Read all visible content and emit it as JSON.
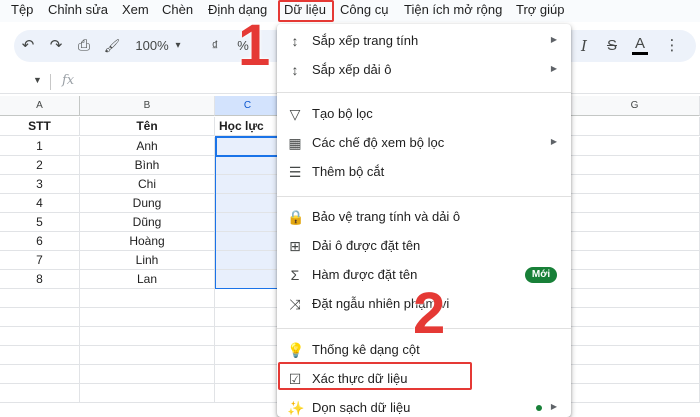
{
  "menubar": {
    "items": [
      {
        "label": "Tệp"
      },
      {
        "label": "Chỉnh sửa"
      },
      {
        "label": "Xem"
      },
      {
        "label": "Chèn"
      },
      {
        "label": "Định dạng"
      },
      {
        "label": "Dữ liệu"
      },
      {
        "label": "Công cụ"
      },
      {
        "label": "Tiện ích mở rộng"
      },
      {
        "label": "Trợ giúp"
      }
    ]
  },
  "toolbar": {
    "undo_icon": "↶",
    "redo_icon": "↷",
    "print_icon": "⎙",
    "paint_format_icon": "🖌",
    "zoom": "100%",
    "zoom_arrow": "▾",
    "currency": "₫",
    "percent": "%",
    "italic": "I",
    "strike": "S",
    "text_color": "A",
    "more": "⋮"
  },
  "formula_bar": {
    "fx": "fx",
    "dropdown": "▼"
  },
  "columns": [
    "A",
    "B",
    "C",
    "G"
  ],
  "table": {
    "headers": [
      "STT",
      "Tên",
      "Học lực"
    ],
    "rows": [
      [
        "1",
        "Anh"
      ],
      [
        "2",
        "Bình"
      ],
      [
        "3",
        "Chi"
      ],
      [
        "4",
        "Dung"
      ],
      [
        "5",
        "Dũng"
      ],
      [
        "6",
        "Hoàng"
      ],
      [
        "7",
        "Linh"
      ],
      [
        "8",
        "Lan"
      ]
    ]
  },
  "data_menu": {
    "items": [
      {
        "label": "Sắp xếp trang tính",
        "icon": "sort-icon"
      },
      {
        "label": "Sắp xếp dải ô",
        "icon": "sort-icon"
      },
      {
        "label": "Tạo bộ lọc",
        "icon": "filter-icon"
      },
      {
        "label": "Các chế độ xem bộ lọc",
        "icon": "filter-views-icon"
      },
      {
        "label": "Thêm bộ cắt",
        "icon": "slicer-icon"
      },
      {
        "label": "Bảo vệ trang tính và dải ô",
        "icon": "lock-icon"
      },
      {
        "label": "Dải ô được đặt tên",
        "icon": "named-range-icon"
      },
      {
        "label": "Hàm được đặt tên",
        "icon": "sigma-icon"
      },
      {
        "label": "Đặt ngẫu nhiên phạm vi",
        "icon": "shuffle-icon"
      },
      {
        "label": "Thống kê dạng cột",
        "icon": "lightbulb-icon"
      },
      {
        "label": "Xác thực dữ liệu",
        "icon": "data-validation-icon"
      },
      {
        "label": "Dọn sạch dữ liệu",
        "icon": "magic-wand-icon"
      }
    ],
    "new_badge": "Mới",
    "submenu_arrow": "▶"
  },
  "annotations": {
    "step1": "1",
    "step2": "2",
    "highlight_color": "#e53935"
  },
  "colors": {
    "accent": "#1a73e8",
    "badge": "#188038"
  }
}
